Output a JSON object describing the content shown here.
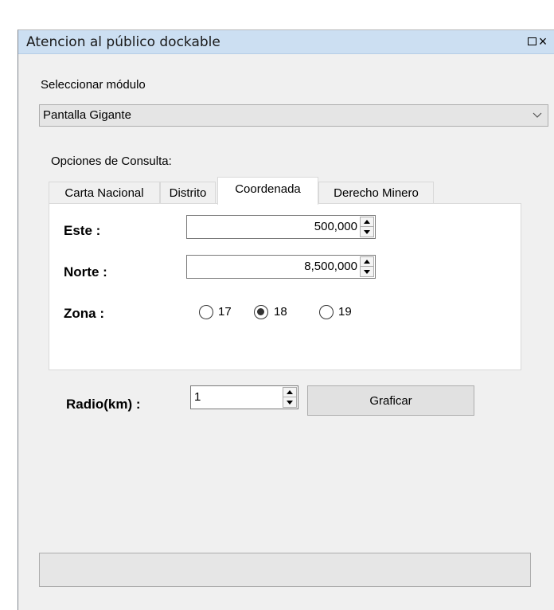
{
  "window": {
    "title": "Atencion al público dockable",
    "maximize_icon": "maximize-icon",
    "close_label": "×"
  },
  "module": {
    "label": "Seleccionar módulo",
    "selected": "Pantalla Gigante"
  },
  "options": {
    "label": "Opciones de Consulta:",
    "tabs": [
      "Carta Nacional",
      "Distrito",
      "Coordenada",
      "Derecho Minero"
    ],
    "active_tab": "Coordenada"
  },
  "coordenada": {
    "este_label": "Este :",
    "este_value": "500,000",
    "norte_label": "Norte :",
    "norte_value": "8,500,000",
    "zona_label": "Zona :",
    "zonas": [
      "17",
      "18",
      "19"
    ],
    "zona_selected": "18"
  },
  "radio_km": {
    "label": "Radio(km) :",
    "value": "1"
  },
  "graficar_label": "Graficar"
}
